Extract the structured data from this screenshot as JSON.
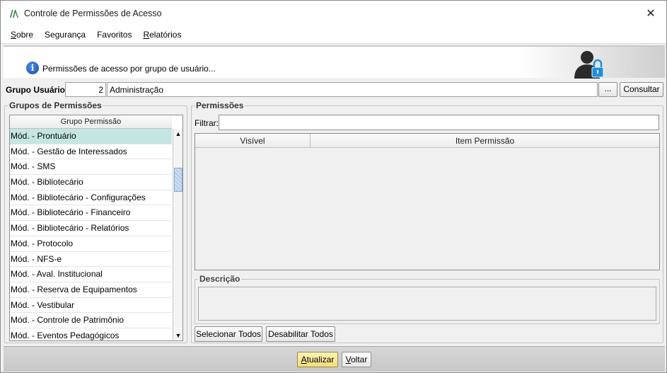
{
  "window": {
    "title": "Controle de Permissões de Acesso",
    "close_symbol": "✕"
  },
  "menu": [
    {
      "first": "S",
      "rest": "obre"
    },
    {
      "first": "",
      "rest": "Segurança"
    },
    {
      "first": "",
      "rest": "Favoritos"
    },
    {
      "first": "R",
      "rest": "elatórios"
    }
  ],
  "banner": {
    "text": "Permissões de acesso por grupo de usuário...",
    "info_icon": "info-icon",
    "user_icon": "user-lock-icon"
  },
  "grupo_usuario": {
    "label": "Grupo Usuário:",
    "id": "2",
    "name": "Administração",
    "lookup_label": "...",
    "consultar_label": "Consultar"
  },
  "grupos_permissoes": {
    "legend": "Grupos de Permissões",
    "column_header": "Grupo Permissão",
    "rows": [
      "Mód. - Prontuário",
      "Mód. - Gestão de Interessados",
      "Mód. - SMS",
      "Mód. - Bibliotecário",
      "Mód. - Bibliotecário - Configurações",
      "Mód. - Bibliotecário - Financeiro",
      "Mód. - Bibliotecário - Relatórios",
      "Mód. - Protocolo",
      "Mód. - NFS-e",
      "Mód. - Aval. Institucional",
      "Mód. - Reserva de Equipamentos",
      "Mód. - Vestibular",
      "Mód. - Controle de Patrimônio",
      "Mód. - Eventos Pedagógicos"
    ],
    "selected_index": 0
  },
  "permissoes": {
    "legend": "Permissões",
    "filtrar_label": "Filtrar:",
    "filtrar_value": "",
    "columns": [
      "Visível",
      "Item Permissão"
    ],
    "descricao_legend": "Descrição",
    "selecionar_todos": "Selecionar Todos",
    "desabilitar_todos": "Desabilitar Todos"
  },
  "footer": {
    "atualizar_first": "A",
    "atualizar_rest": "tualizar",
    "voltar_first": "V",
    "voltar_rest": "oltar"
  },
  "colors": {
    "selected_row": "#c4e6e2",
    "primary_button": "#f2dc7a",
    "info_blue": "#1d4fa8",
    "lock_blue": "#1e8fe0"
  }
}
